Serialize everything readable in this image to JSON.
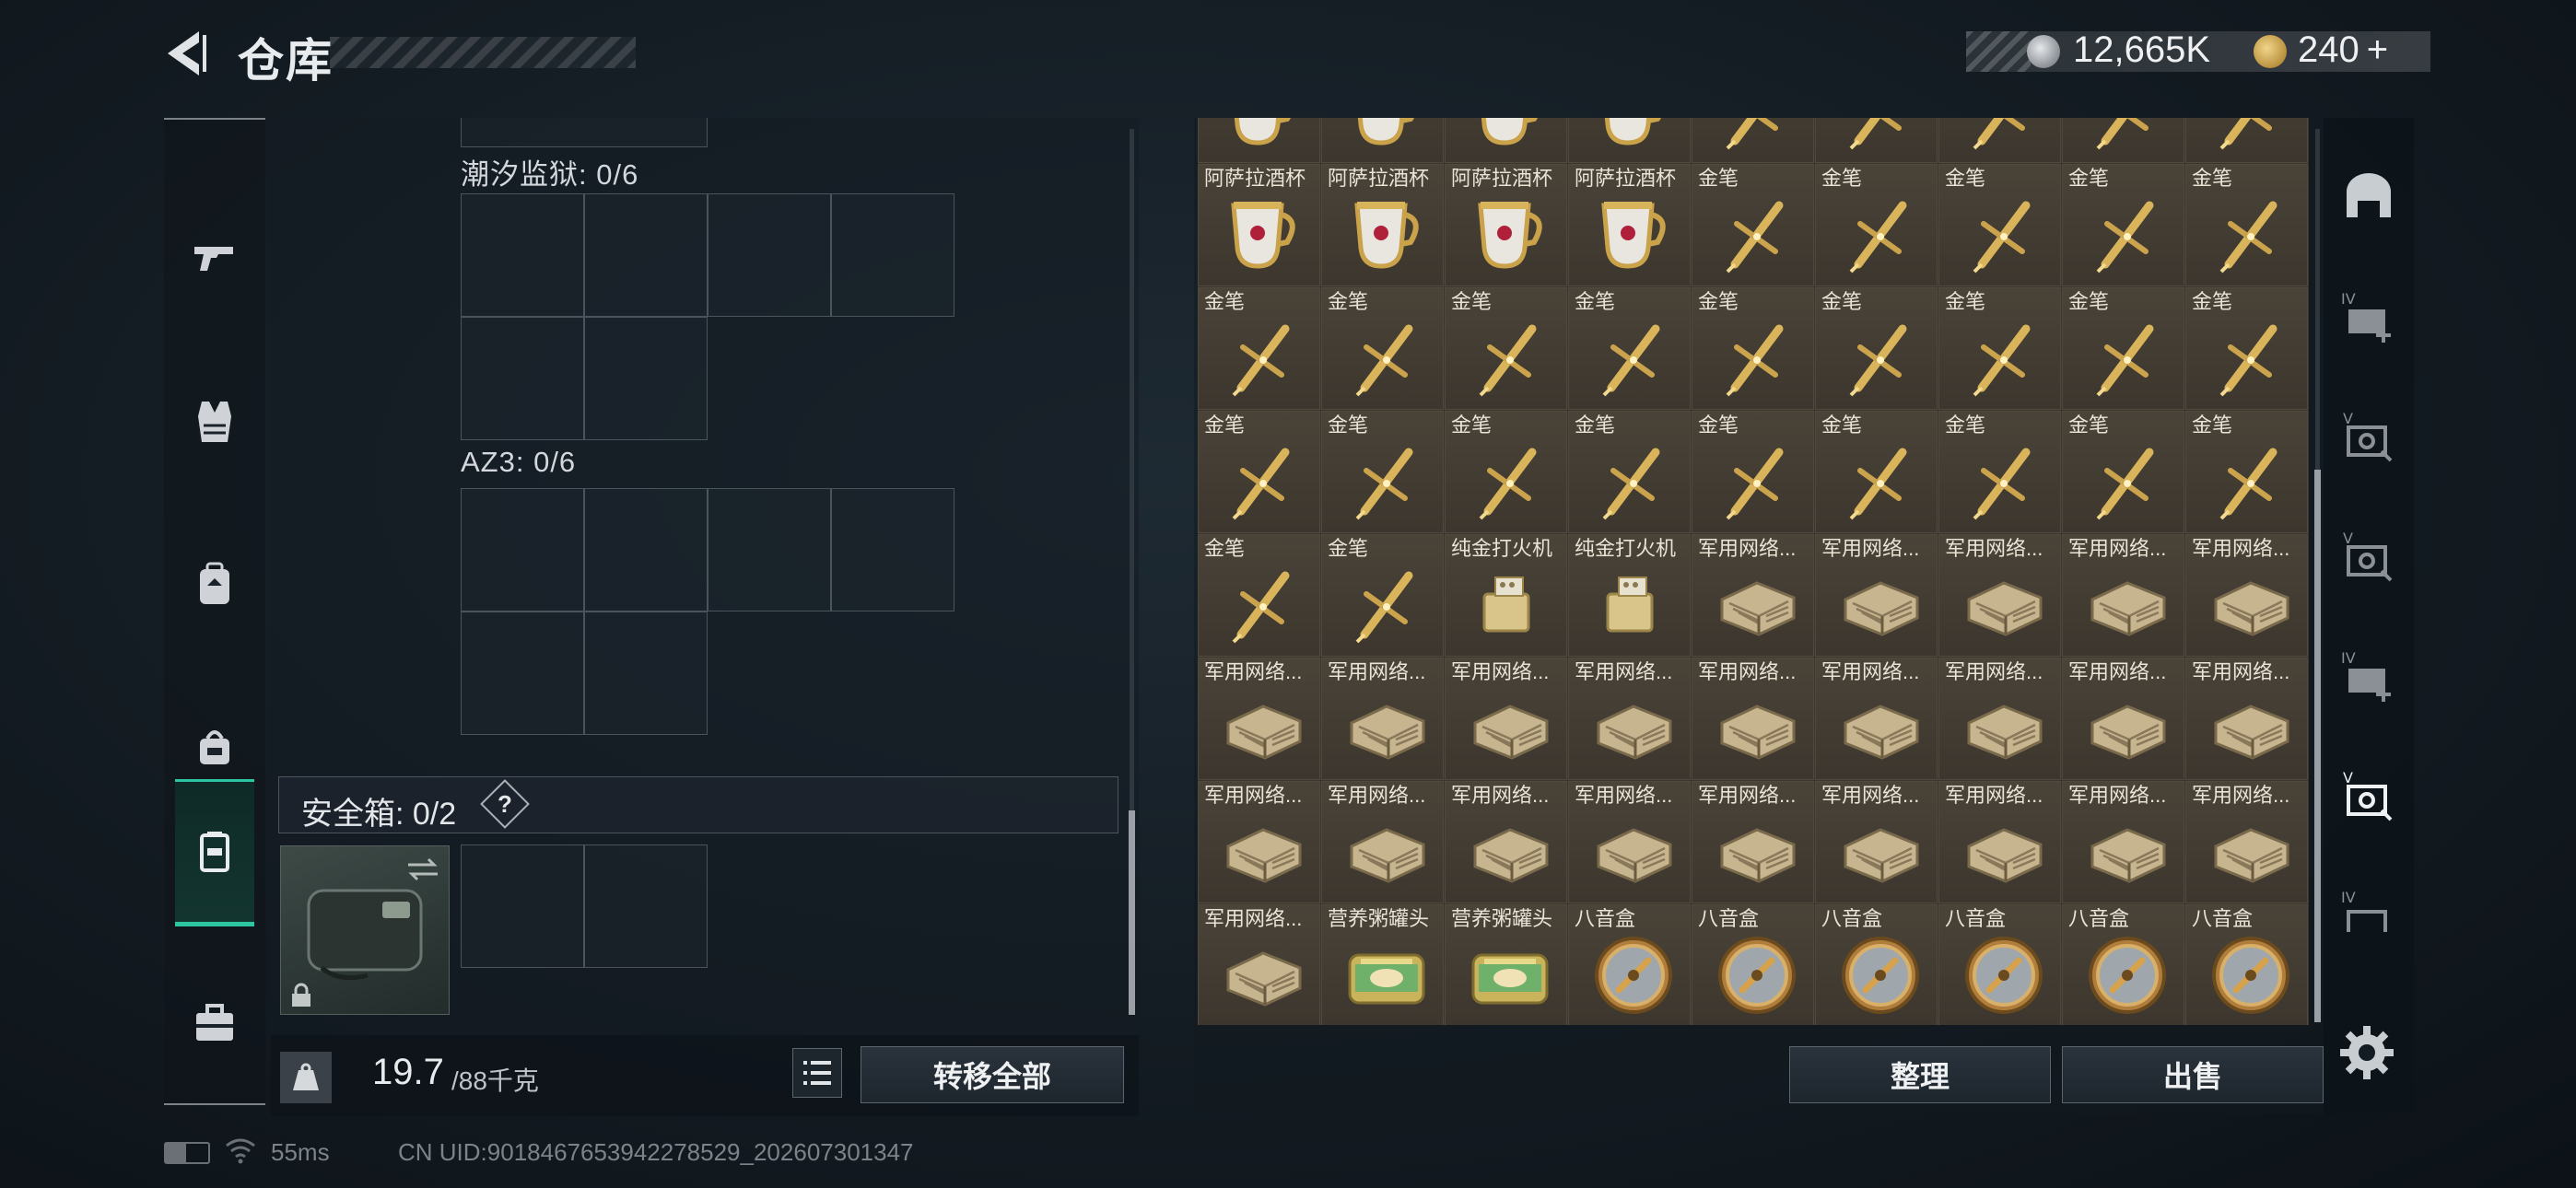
{
  "header": {
    "title": "仓库",
    "silver_amount": "12,665K",
    "gold_amount": "240",
    "gold_plus": "+"
  },
  "left_panel": {
    "sections": [
      {
        "label": "潮汐监狱: 0/6"
      },
      {
        "label": "AZ3: 0/6"
      }
    ],
    "safebox_label": "安全箱: 0/2",
    "help": "?",
    "weight_value": "19.7",
    "weight_max": "/88千克",
    "transfer_all": "转移全部"
  },
  "items": {
    "names": [
      "阿萨拉酒杯",
      "阿萨拉酒杯",
      "阿萨拉酒杯",
      "阿萨拉酒杯",
      "金笔",
      "金笔",
      "金笔",
      "金笔",
      "金笔",
      "金笔",
      "金笔",
      "金笔",
      "金笔",
      "金笔",
      "金笔",
      "金笔",
      "金笔",
      "金笔",
      "金笔",
      "金笔",
      "金笔",
      "金笔",
      "金笔",
      "金笔",
      "金笔",
      "金笔",
      "金笔",
      "金笔",
      "金笔",
      "纯金打火机",
      "纯金打火机",
      "军用网络...",
      "军用网络...",
      "军用网络...",
      "军用网络...",
      "军用网络...",
      "军用网络...",
      "军用网络...",
      "军用网络...",
      "军用网络...",
      "军用网络...",
      "军用网络...",
      "军用网络...",
      "军用网络...",
      "军用网络...",
      "军用网络...",
      "军用网络...",
      "军用网络...",
      "军用网络...",
      "军用网络...",
      "军用网络...",
      "军用网络...",
      "军用网络...",
      "军用网络...",
      "军用网络...",
      "营养粥罐头",
      "营养粥罐头",
      "八音盒",
      "八音盒",
      "八音盒",
      "八音盒",
      "八音盒",
      "八音盒"
    ],
    "types": [
      "cup",
      "cup",
      "cup",
      "cup",
      "pen",
      "pen",
      "pen",
      "pen",
      "pen",
      "pen",
      "pen",
      "pen",
      "pen",
      "pen",
      "pen",
      "pen",
      "pen",
      "pen",
      "pen",
      "pen",
      "pen",
      "pen",
      "pen",
      "pen",
      "pen",
      "pen",
      "pen",
      "pen",
      "pen",
      "lighter",
      "lighter",
      "router",
      "router",
      "router",
      "router",
      "router",
      "router",
      "router",
      "router",
      "router",
      "router",
      "router",
      "router",
      "router",
      "router",
      "router",
      "router",
      "router",
      "router",
      "router",
      "router",
      "router",
      "router",
      "router",
      "router",
      "can",
      "can",
      "musicbox",
      "musicbox",
      "musicbox",
      "musicbox",
      "musicbox",
      "musicbox"
    ]
  },
  "actions": {
    "sort": "整理",
    "sell": "出售"
  },
  "left_nav_icons": [
    "pistol-icon",
    "vest-icon",
    "backpack-icon",
    "chest-rig-icon",
    "safebox-icon",
    "briefcase-icon"
  ],
  "right_nav_icons": [
    "bunker-icon",
    "level4-add-icon",
    "level5-gear-icon",
    "level5-gear-icon-2",
    "level4-add-icon-2",
    "level5-gear-icon-active",
    "level4-icon"
  ],
  "status": {
    "ping": "55ms",
    "uid": "CN UID:9018467653942278529_202607301347"
  },
  "colors": {
    "accent": "#2cc6a2",
    "gold": "#c9a24a",
    "item_bg": "#453e34"
  }
}
